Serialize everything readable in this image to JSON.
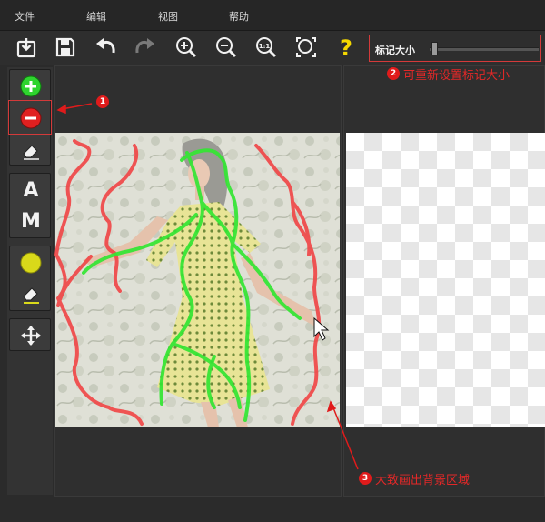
{
  "menu": {
    "file": "文件",
    "edit": "编辑",
    "view": "视图",
    "help": "帮助"
  },
  "toolbar": {
    "buttons": [
      "open-icon",
      "save-icon",
      "undo-icon",
      "redo-icon",
      "zoom-in-icon",
      "zoom-out-icon",
      "actual-size-icon",
      "fit-icon",
      "help-icon"
    ],
    "actual_size_label": "1:1",
    "help_label": "?",
    "marker_size_label": "标记大小",
    "marker_size_value": 0.05
  },
  "palette": {
    "letter_a": "A",
    "letter_m": "M",
    "tools": [
      "keep-marker-icon",
      "remove-marker-icon",
      "eraser-icon",
      "auto-icon",
      "manual-icon",
      "hair-color-icon",
      "hair-eraser-icon",
      "move-icon"
    ]
  },
  "annotations": {
    "num1": "1",
    "num2": "2",
    "num3": "3",
    "text2": "可重新设置标记大小",
    "text3": "大致画出背景区域"
  },
  "colors": {
    "accent_red": "#e01b1b",
    "keep_green": "#2fd42f",
    "remove_red": "#e02020",
    "stroke_red": "#f04848",
    "stroke_green": "#33e633",
    "hair_yellow": "#d9d91a"
  }
}
